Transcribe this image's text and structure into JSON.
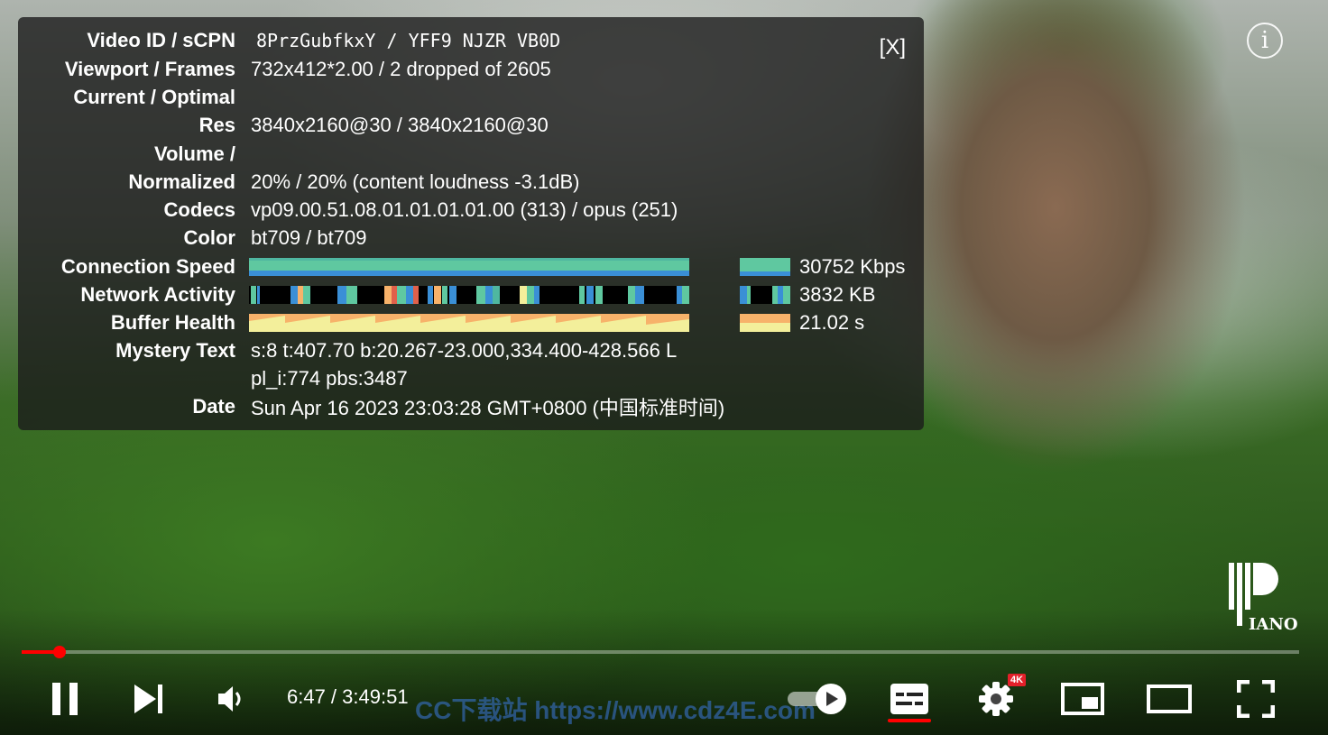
{
  "stats_panel": {
    "close_label": "[X]",
    "rows": [
      {
        "label": "Video ID / sCPN",
        "value": "8PrzGubfkxY / YFF9 NJZR VB0D"
      },
      {
        "label": "Viewport / Frames",
        "value": "732x412*2.00 / 2 dropped of 2605"
      },
      {
        "label": "Current / Optimal",
        "value": ""
      },
      {
        "label": "Res",
        "value": "3840x2160@30 / 3840x2160@30"
      },
      {
        "label": "Volume /",
        "value": ""
      },
      {
        "label": "Normalized",
        "value": "20% / 20% (content loudness -3.1dB)"
      },
      {
        "label": "Codecs",
        "value": "vp09.00.51.08.01.01.01.01.00 (313) / opus (251)"
      },
      {
        "label": "Color",
        "value": "bt709 / bt709"
      },
      {
        "label": "Connection Speed",
        "value": "30752 Kbps"
      },
      {
        "label": "Network Activity",
        "value": "3832 KB"
      },
      {
        "label": "Buffer Health",
        "value": "21.02 s"
      },
      {
        "label": "Mystery Text",
        "value": "s:8 t:407.70 b:20.267-23.000,334.400-428.566 L"
      },
      {
        "label": "",
        "value": "pl_i:774 pbs:3487"
      },
      {
        "label": "Date",
        "value": "Sun Apr 16 2023 23:03:28 GMT+0800 (中国标准时间)"
      }
    ]
  },
  "player": {
    "time": "6:47 / 3:49:51",
    "progress_fraction": 0.03,
    "settings_badge": "4K",
    "channel_logo_text": "IANO",
    "watermark": "CC下载站 https://www.cdz4E.com"
  },
  "colors": {
    "accent": "#ff0000",
    "connection_bar": "#5fc8a0",
    "network_bar": "#3a8fd6",
    "buffer_bar": "#f7b26a",
    "buffer_highlight": "#f3ef9b"
  },
  "icons": {
    "pause": "pause-icon",
    "next": "next-icon",
    "volume": "volume-icon",
    "autoplay": "autoplay-toggle-icon",
    "subtitles": "subtitles-icon",
    "settings": "gear-icon",
    "miniplayer": "miniplayer-icon",
    "theater": "theater-mode-icon",
    "fullscreen": "fullscreen-icon",
    "info": "info-icon"
  }
}
